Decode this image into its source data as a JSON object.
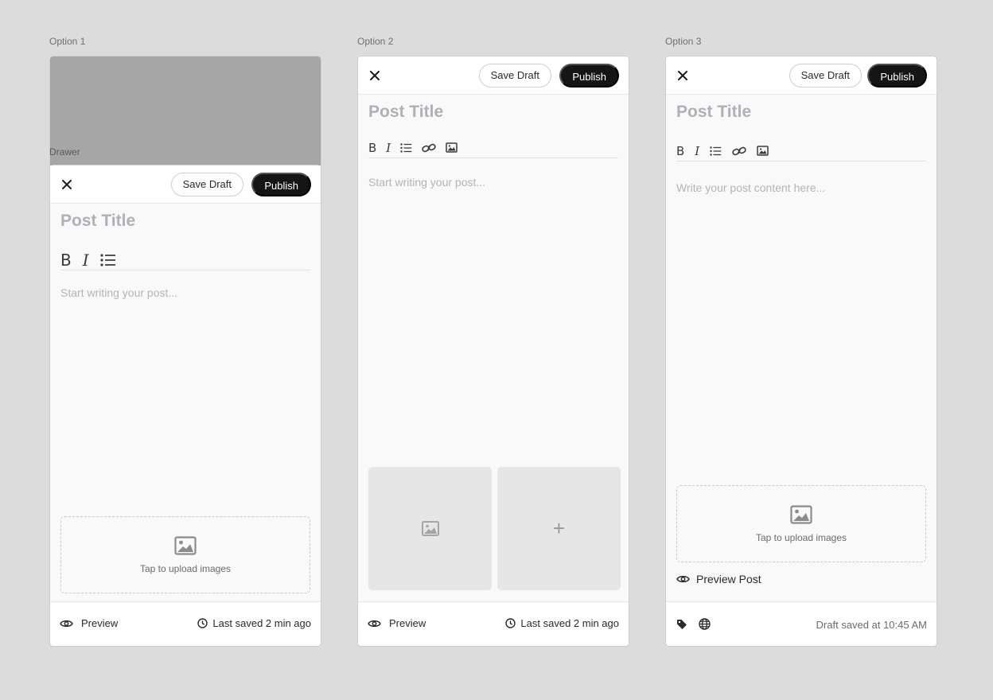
{
  "options": [
    {
      "label": "Option 1"
    },
    {
      "label": "Option 2"
    },
    {
      "label": "Option 3"
    }
  ],
  "drawer_label": "Drawer",
  "common": {
    "save_draft": "Save Draft",
    "publish": "Publish",
    "title_placeholder": "Post Title",
    "preview": "Preview",
    "last_saved": "Last saved 2 min ago",
    "upload_text": "Tap to upload images"
  },
  "option1": {
    "body_placeholder": "Start writing your post..."
  },
  "option2": {
    "body_placeholder": "Start writing your post...",
    "add_symbol": "+"
  },
  "option3": {
    "body_placeholder": "Write your post content here...",
    "preview_post": "Preview Post",
    "draft_saved": "Draft saved at 10:45 AM"
  },
  "icons": {
    "close": "close-icon",
    "bold": "B",
    "italic": "I",
    "list": "list-icon",
    "link": "link-icon",
    "image": "image-icon",
    "eye": "eye-icon",
    "clock": "clock-icon",
    "tag": "tag-icon",
    "globe": "globe-icon"
  },
  "colors": {
    "background": "#dcdcdc",
    "publish_bg": "#151515",
    "placeholder": "#b3b3bb",
    "title_placeholder": "#b0b0b8",
    "overlay": "#a6a6a6"
  }
}
